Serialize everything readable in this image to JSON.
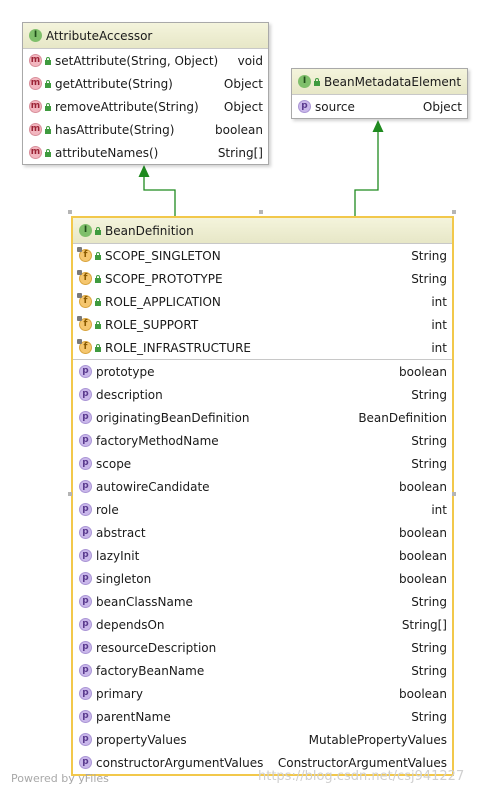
{
  "attribute_accessor": {
    "title": "AttributeAccessor",
    "methods": [
      {
        "name": "setAttribute(String, Object)",
        "type": "void"
      },
      {
        "name": "getAttribute(String)",
        "type": "Object"
      },
      {
        "name": "removeAttribute(String)",
        "type": "Object"
      },
      {
        "name": "hasAttribute(String)",
        "type": "boolean"
      },
      {
        "name": "attributeNames()",
        "type": "String[]"
      }
    ]
  },
  "bean_metadata_element": {
    "title": "BeanMetadataElement",
    "properties": [
      {
        "name": "source",
        "type": "Object"
      }
    ]
  },
  "bean_definition": {
    "title": "BeanDefinition",
    "fields": [
      {
        "name": "SCOPE_SINGLETON",
        "type": "String"
      },
      {
        "name": "SCOPE_PROTOTYPE",
        "type": "String"
      },
      {
        "name": "ROLE_APPLICATION",
        "type": "int"
      },
      {
        "name": "ROLE_SUPPORT",
        "type": "int"
      },
      {
        "name": "ROLE_INFRASTRUCTURE",
        "type": "int"
      }
    ],
    "properties": [
      {
        "name": "prototype",
        "type": "boolean"
      },
      {
        "name": "description",
        "type": "String"
      },
      {
        "name": "originatingBeanDefinition",
        "type": "BeanDefinition"
      },
      {
        "name": "factoryMethodName",
        "type": "String"
      },
      {
        "name": "scope",
        "type": "String"
      },
      {
        "name": "autowireCandidate",
        "type": "boolean"
      },
      {
        "name": "role",
        "type": "int"
      },
      {
        "name": "abstract",
        "type": "boolean"
      },
      {
        "name": "lazyInit",
        "type": "boolean"
      },
      {
        "name": "singleton",
        "type": "boolean"
      },
      {
        "name": "beanClassName",
        "type": "String"
      },
      {
        "name": "dependsOn",
        "type": "String[]"
      },
      {
        "name": "resourceDescription",
        "type": "String"
      },
      {
        "name": "factoryBeanName",
        "type": "String"
      },
      {
        "name": "primary",
        "type": "boolean"
      },
      {
        "name": "parentName",
        "type": "String"
      },
      {
        "name": "propertyValues",
        "type": "MutablePropertyValues"
      },
      {
        "name": "constructorArgumentValues",
        "type": "ConstructorArgumentValues"
      }
    ]
  },
  "icons": {
    "interface": "I",
    "method": "m",
    "property": "p",
    "field": "f"
  },
  "colors": {
    "arrow": "#1f8a1f",
    "selection": "#f2c84b",
    "header_bg": "#eeeed2"
  },
  "footer": {
    "powered_by": "Powered by yFiles",
    "watermark": "https://blog.csdn.net/csj941227"
  }
}
